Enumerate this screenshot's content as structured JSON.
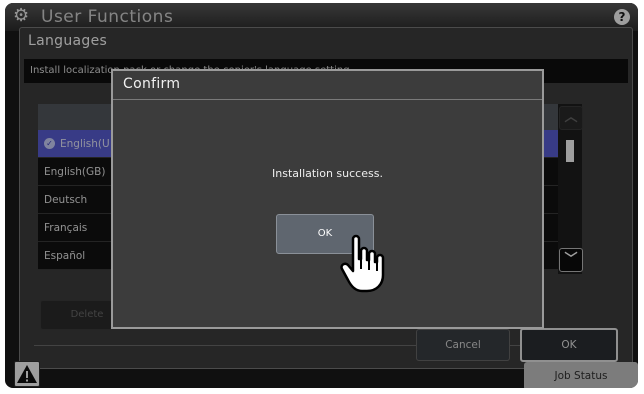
{
  "header": {
    "title": "User Functions",
    "gear_icon": "gear-icon",
    "help_icon_glyph": "?"
  },
  "panel": {
    "title": "Languages",
    "description": "Install localization pack or change the copier's language setting."
  },
  "language_list": {
    "rows": [
      {
        "label": "English(U",
        "selected": true
      },
      {
        "label": "English(GB)",
        "selected": false
      },
      {
        "label": "Deutsch",
        "selected": false
      },
      {
        "label": "Français",
        "selected": false
      },
      {
        "label": "Español",
        "selected": false
      }
    ],
    "scroll_up_glyph": "︿",
    "scroll_down_glyph": "﹀"
  },
  "buttons": {
    "delete": "Delete",
    "cancel": "Cancel",
    "ok": "OK",
    "job_status": "Job Status"
  },
  "dialog": {
    "title": "Confirm",
    "message": "Installation success.",
    "ok": "OK"
  },
  "colors": {
    "accent_selected": "#5b5fd8",
    "screen_bg": "#1b1b1b",
    "panel_bg": "#3e3e3e"
  }
}
